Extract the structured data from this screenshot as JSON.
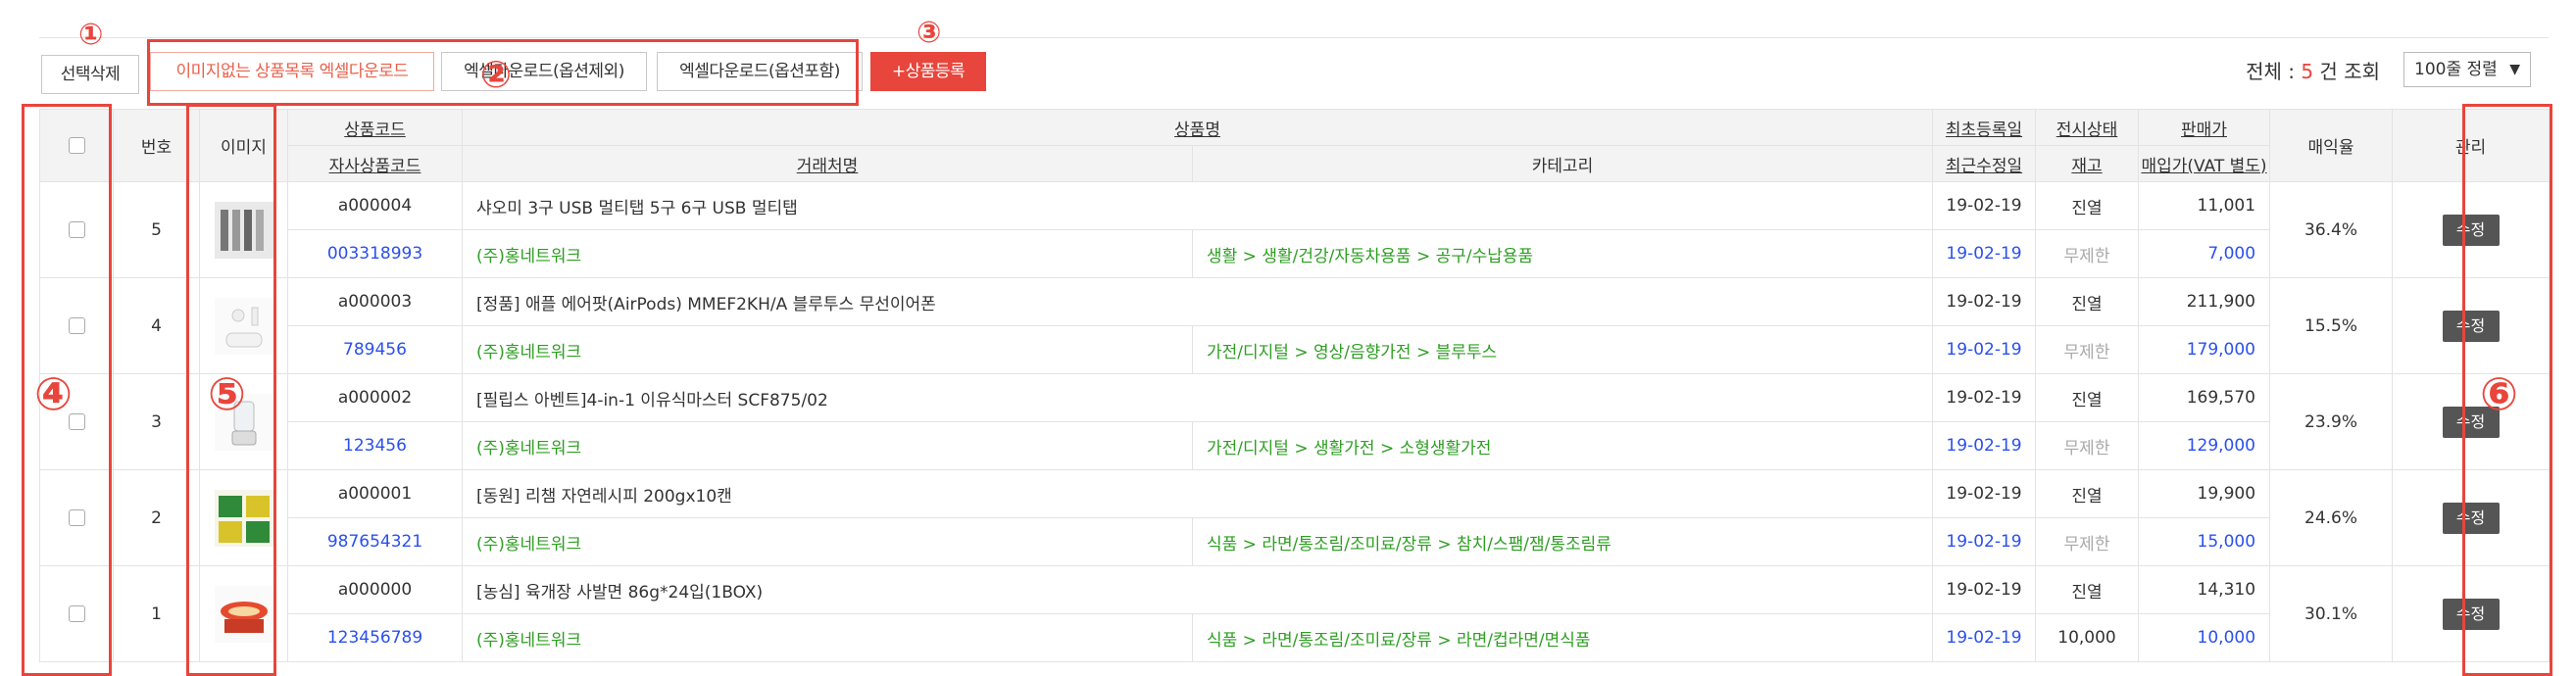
{
  "toolbar": {
    "select_delete": "선택삭제",
    "excel_no_image": "이미지없는 상품목록 엑셀다운로드",
    "excel_no_option": "엑셀다운로드(옵션제외)",
    "excel_with_option": "엑셀다운로드(옵션포함)",
    "add_product": "+상품등록"
  },
  "summary": {
    "prefix": "전체 : ",
    "count": "5",
    "suffix": " 건 조회"
  },
  "sort": {
    "selected": "100줄 정렬",
    "arrow": "▼"
  },
  "headers": {
    "number": "번호",
    "image": "이미지",
    "product_code": "상품코드",
    "own_code": "자사상품코드",
    "product_name": "상품명",
    "vendor": "거래처명",
    "category": "카테고리",
    "first_reg": "최초등록일",
    "last_mod": "최근수정일",
    "display_status": "전시상태",
    "stock": "재고",
    "sale_price": "판매가",
    "purchase_price": "매입가(VAT 별도)",
    "margin": "매익율",
    "manage": "관리"
  },
  "rows": [
    {
      "no": "5",
      "code": "a000004",
      "name": "샤오미 3구 USB 멀티탭 5구 6구 USB 멀티탭",
      "own_code": "003318993",
      "vendor": "(주)홍네트워크",
      "category": "생활 > 생활/건강/자동차용품 > 공구/수납용품",
      "reg_date": "19-02-19",
      "mod_date": "19-02-19",
      "status": "진열",
      "stock": "무제한",
      "price": "11,001",
      "cost": "7,000",
      "margin": "36.4%",
      "edit": "수정"
    },
    {
      "no": "4",
      "code": "a000003",
      "name": "[정품] 애플 에어팟(AirPods) MMEF2KH/A 블루투스 무선이어폰",
      "own_code": "789456",
      "vendor": "(주)홍네트워크",
      "category": "가전/디지털 > 영상/음향가전 > 블루투스",
      "reg_date": "19-02-19",
      "mod_date": "19-02-19",
      "status": "진열",
      "stock": "무제한",
      "price": "211,900",
      "cost": "179,000",
      "margin": "15.5%",
      "edit": "수정"
    },
    {
      "no": "3",
      "code": "a000002",
      "name": "[필립스 아벤트]4-in-1 이유식마스터 SCF875/02",
      "own_code": "123456",
      "vendor": "(주)홍네트워크",
      "category": "가전/디지털 > 생활가전 > 소형생활가전",
      "reg_date": "19-02-19",
      "mod_date": "19-02-19",
      "status": "진열",
      "stock": "무제한",
      "price": "169,570",
      "cost": "129,000",
      "margin": "23.9%",
      "edit": "수정"
    },
    {
      "no": "2",
      "code": "a000001",
      "name": "[동원] 리챔 자연레시피 200gx10캔",
      "own_code": "987654321",
      "vendor": "(주)홍네트워크",
      "category": "식품 > 라면/통조림/조미료/장류 > 참치/스팸/잼/통조림류",
      "reg_date": "19-02-19",
      "mod_date": "19-02-19",
      "status": "진열",
      "stock": "무제한",
      "price": "19,900",
      "cost": "15,000",
      "margin": "24.6%",
      "edit": "수정"
    },
    {
      "no": "1",
      "code": "a000000",
      "name": "[농심] 육개장 사발면 86g*24입(1BOX)",
      "own_code": "123456789",
      "vendor": "(주)홍네트워크",
      "category": "식품 > 라면/통조림/조미료/장류 > 라면/컵라면/면식품",
      "reg_date": "19-02-19",
      "mod_date": "19-02-19",
      "status": "진열",
      "stock": "10,000",
      "price": "14,310",
      "cost": "10,000",
      "margin": "30.1%",
      "edit": "수정"
    }
  ],
  "annotations": [
    "①",
    "②",
    "③",
    "④",
    "⑤",
    "⑥"
  ],
  "colors": {
    "accent": "#e8453c",
    "link_blue": "#2a4ff0",
    "category_green": "#2e9e22",
    "header_bg": "#f3f3f3"
  }
}
